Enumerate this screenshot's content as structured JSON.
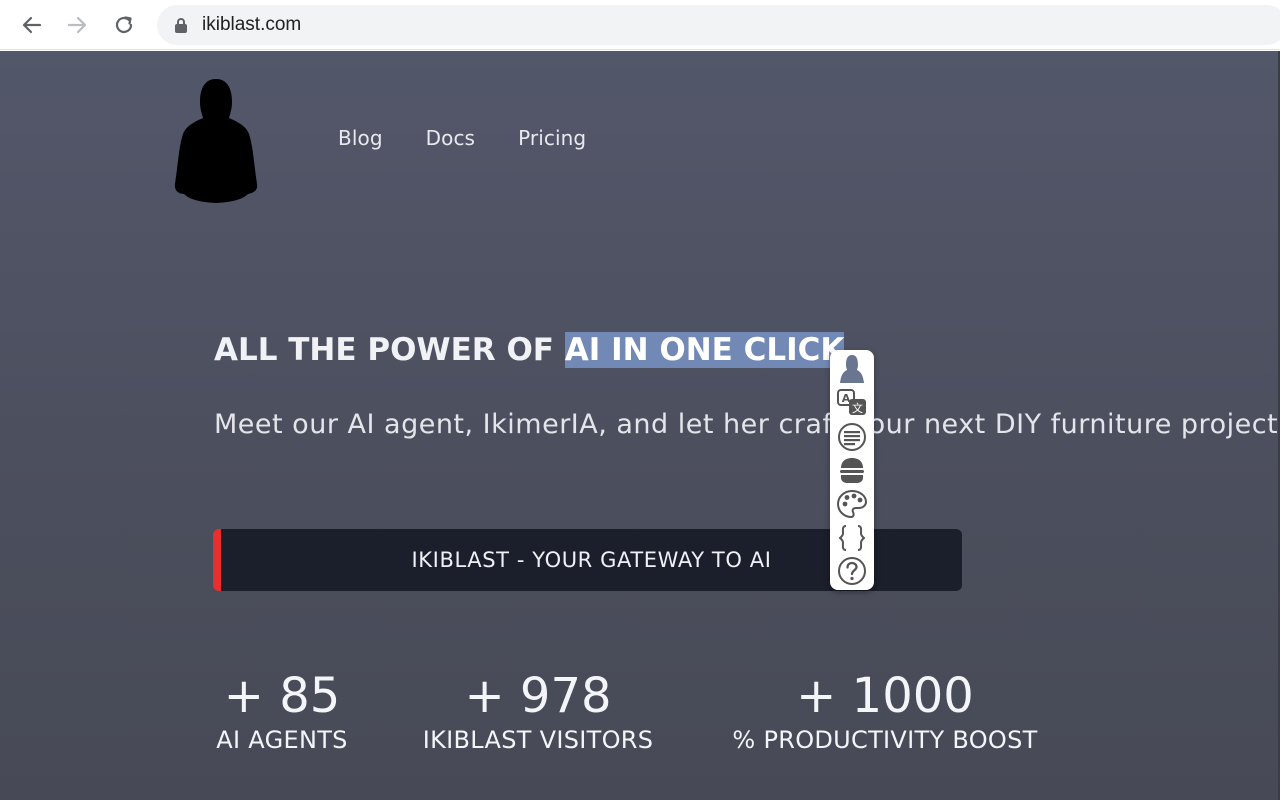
{
  "browser": {
    "url": "ikiblast.com",
    "icons": [
      "back-arrow-icon",
      "forward-arrow-icon",
      "reload-icon",
      "lock-icon"
    ]
  },
  "site": {
    "logo_icon": "hooded-figure-silhouette",
    "nav": [
      {
        "label": "Blog"
      },
      {
        "label": "Docs"
      },
      {
        "label": "Pricing"
      }
    ],
    "headline": {
      "plain": "ALL THE POWER OF ",
      "highlighted": "AI IN ONE CLICK"
    },
    "subheadline": "Meet our AI agent, IkimerIA, and let her craft your next DIY furniture project",
    "cta": {
      "label": "IKIBLAST - YOUR GATEWAY TO AI",
      "accent": "#ea2d2d"
    },
    "stats": [
      {
        "value": "+ 85",
        "label": "AI AGENTS"
      },
      {
        "value": "+ 978",
        "label": "IKIBLAST VISITORS"
      },
      {
        "value": "+ 1000",
        "label": "% PRODUCTIVITY BOOST"
      }
    ]
  },
  "popup_toolbar": {
    "icons": [
      "avatar-icon",
      "translate-icon",
      "summarize-icon",
      "burger-icon",
      "palette-icon",
      "code-braces-icon",
      "help-icon"
    ]
  },
  "colors": {
    "page_bg": "#4f5362",
    "selection": "#7289b5",
    "cta_bg": "#1b1e2b"
  }
}
